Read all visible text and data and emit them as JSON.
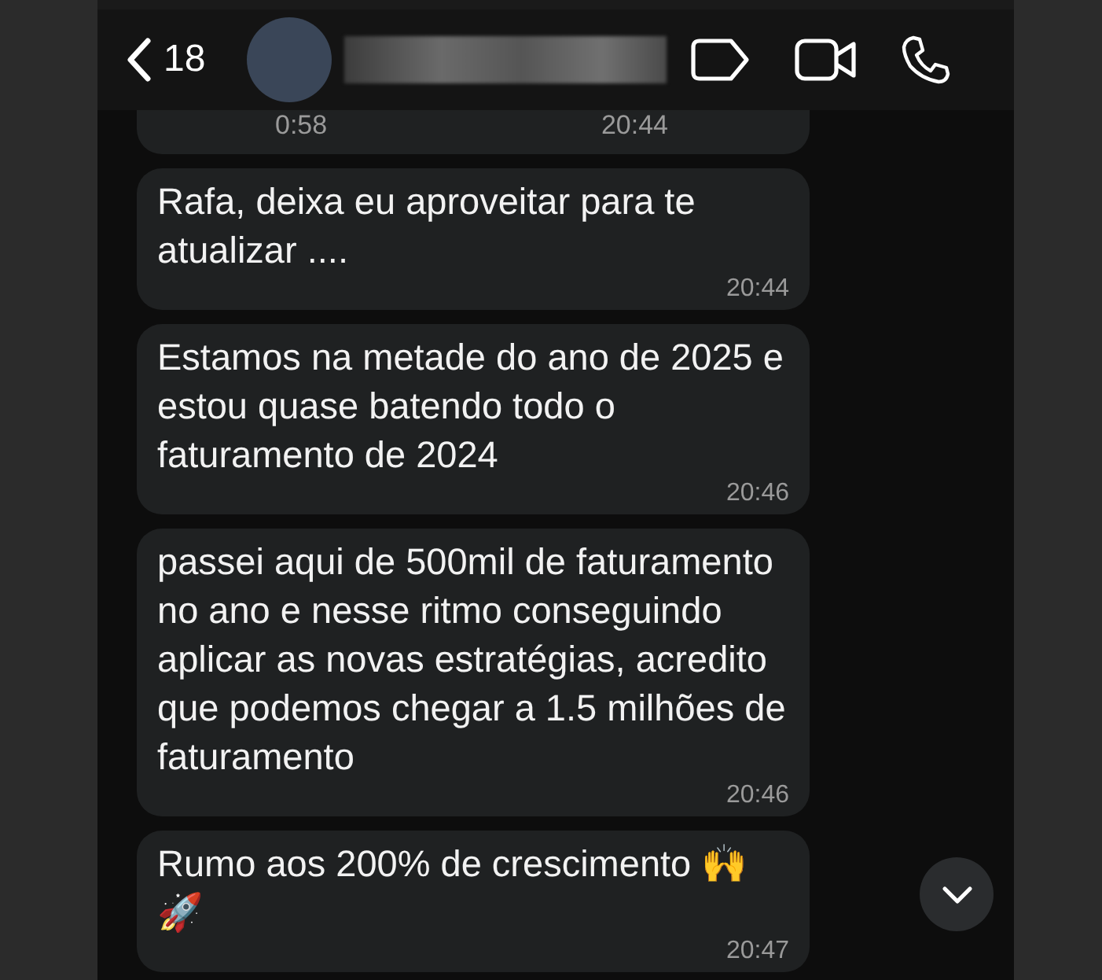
{
  "header": {
    "back_count": "18"
  },
  "voice_message": {
    "duration": "0:58",
    "time": "20:44"
  },
  "messages": [
    {
      "text": "Rafa, deixa eu aproveitar para te atualizar ....",
      "time": "20:44"
    },
    {
      "text": "Estamos na metade do ano de 2025 e estou quase batendo todo o faturamento de 2024",
      "time": "20:46"
    },
    {
      "text": "passei aqui de 500mil de faturamento no ano e nesse ritmo conseguindo aplicar as novas estratégias, acredito que podemos chegar a 1.5 milhões de faturamento",
      "time": "20:46"
    },
    {
      "text": "Rumo aos 200% de crescimento 🙌🚀",
      "time": "20:47"
    }
  ]
}
